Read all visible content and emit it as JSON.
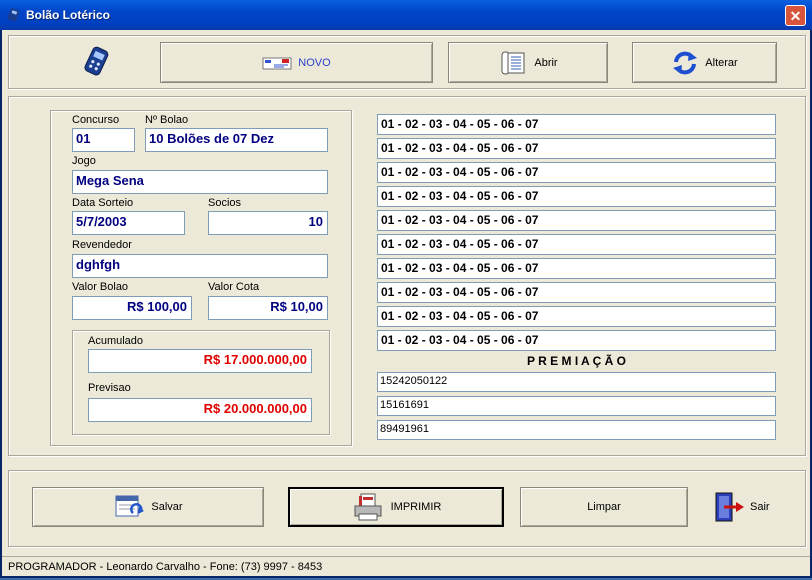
{
  "window": {
    "title": "Bolão Lotérico",
    "close_label": "✕"
  },
  "toolbar": {
    "novo": "NOVO",
    "abrir": "Abrir",
    "alterar": "Alterar"
  },
  "form": {
    "concurso_label": "Concurso",
    "concurso_value": "01",
    "nbolao_label": "Nº Bolao",
    "nbolao_value": "10 Bolões de 07 Dez",
    "jogo_label": "Jogo",
    "jogo_value": "Mega Sena",
    "data_label": "Data Sorteio",
    "data_value": "5/7/2003",
    "socios_label": "Socios",
    "socios_value": "10",
    "revendedor_label": "Revendedor",
    "revendedor_value": "dghfgh",
    "valor_bolao_label": "Valor Bolao",
    "valor_bolao_value": "R$ 100,00",
    "valor_cota_label": "Valor Cota",
    "valor_cota_value": "R$ 10,00",
    "acumulado_label": "Acumulado",
    "acumulado_value": "R$ 17.000.000,00",
    "previsao_label": "Previsao",
    "previsao_value": "R$ 20.000.000,00"
  },
  "numbers": [
    "01 - 02 - 03 - 04 - 05 - 06 - 07",
    "01 - 02 - 03 - 04 - 05 - 06 - 07",
    "01 - 02 - 03 - 04 - 05 - 06 - 07",
    "01 - 02 - 03 - 04 - 05 - 06 - 07",
    "01 - 02 - 03 - 04 - 05 - 06 - 07",
    "01 - 02 - 03 - 04 - 05 - 06 - 07",
    "01 - 02 - 03 - 04 - 05 - 06 - 07",
    "01 - 02 - 03 - 04 - 05 - 06 - 07",
    "01 - 02 - 03 - 04 - 05 - 06 - 07",
    "01 - 02 - 03 - 04 - 05 - 06 - 07"
  ],
  "premiacao": {
    "title": "P R E M I A Ç Ã O",
    "values": [
      "15242050122",
      "15161691",
      "89491961"
    ]
  },
  "actions": {
    "salvar": "Salvar",
    "imprimir": "IMPRIMIR",
    "limpar": "Limpar",
    "sair": "Sair"
  },
  "status": "PROGRAMADOR - Leonardo Carvalho - Fone: (73) 9997 - 8453",
  "colors": {
    "title_bar": "#0045c8",
    "field_text": "#000080",
    "money_red": "#e00000",
    "window_bg": "#ece9d8"
  }
}
